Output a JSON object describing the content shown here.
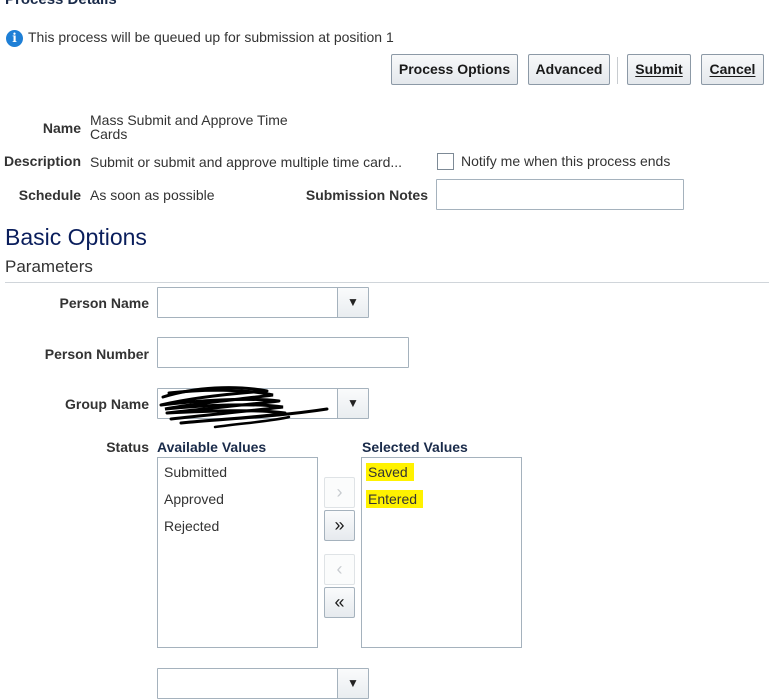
{
  "page": {
    "heading": "Process Details",
    "info_message": "This process will be queued up for submission at position 1"
  },
  "toolbar": {
    "process_options": "Process Options",
    "advanced": "Advanced",
    "submit": "Submit",
    "cancel": "Cancel"
  },
  "details": {
    "name_label": "Name",
    "name_value_line1": "Mass Submit and Approve Time",
    "name_value_line2": "Cards",
    "description_label": "Description",
    "description_value": "Submit or submit and approve multiple time card...",
    "notify_label": "Notify me when this process ends",
    "notify_checked": false,
    "schedule_label": "Schedule",
    "schedule_value": "As soon as possible",
    "submission_notes_label": "Submission Notes",
    "submission_notes_value": ""
  },
  "basic_options": {
    "title": "Basic Options",
    "parameters_title": "Parameters",
    "person_name_label": "Person Name",
    "person_name_value": "",
    "person_number_label": "Person Number",
    "person_number_value": "",
    "group_name_label": "Group Name",
    "status_label": "Status",
    "available_heading": "Available Values",
    "available_values": [
      "Submitted",
      "Approved",
      "Rejected"
    ],
    "selected_heading": "Selected Values",
    "selected_values": [
      "Saved",
      "Entered"
    ],
    "highlight_color": "#fff200"
  },
  "icons": {
    "info": "info-icon",
    "dropdown": "triangle-down-icon",
    "move_right": "chevron-right-icon",
    "move_all_right": "double-chevron-right-icon",
    "move_left": "chevron-left-icon",
    "move_all_left": "double-chevron-left-icon"
  }
}
